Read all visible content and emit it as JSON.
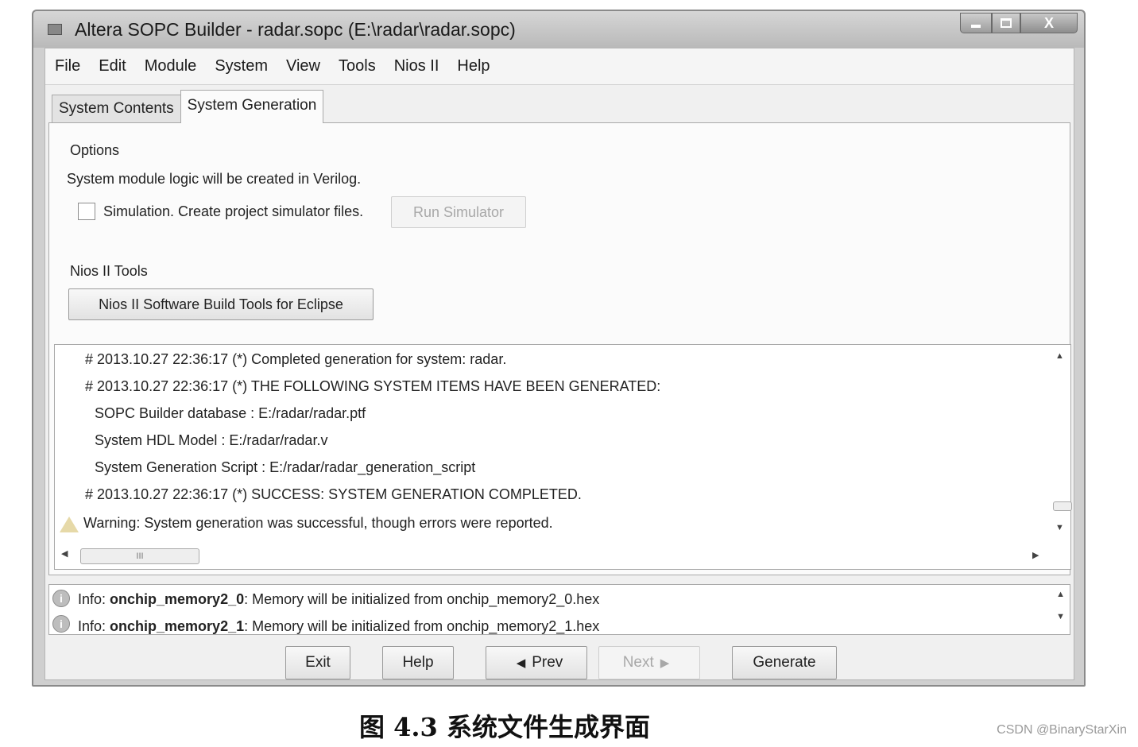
{
  "window": {
    "title": "Altera SOPC Builder - radar.sopc (E:\\radar\\radar.sopc)"
  },
  "menu": [
    "File",
    "Edit",
    "Module",
    "System",
    "View",
    "Tools",
    "Nios II",
    "Help"
  ],
  "tabs": [
    "System Contents",
    "System Generation"
  ],
  "active_tab": "System Generation",
  "options": {
    "label": "Options",
    "verilog_text": "System module logic will be created in Verilog.",
    "simulation_label": "Simulation. Create project simulator files.",
    "simulation_checked": false,
    "run_simulator": "Run Simulator"
  },
  "nios_tools": {
    "label": "Nios II Tools",
    "eclipse_button": "Nios II Software Build Tools for Eclipse"
  },
  "log": [
    "# 2013.10.27 22:36:17 (*) Completed generation for system: radar.",
    "# 2013.10.27 22:36:17 (*) THE FOLLOWING SYSTEM ITEMS HAVE BEEN GENERATED:",
    "SOPC Builder database : E:/radar/radar.ptf",
    "System HDL Model : E:/radar/radar.v",
    "System Generation Script : E:/radar/radar_generation_script",
    "# 2013.10.27 22:36:17 (*) SUCCESS: SYSTEM GENERATION COMPLETED.",
    "Warning: System generation was successful, though errors were reported."
  ],
  "info": [
    {
      "prefix": "Info: ",
      "name": "onchip_memory2_0",
      "text": ": Memory will be initialized from onchip_memory2_0.hex"
    },
    {
      "prefix": "Info: ",
      "name": "onchip_memory2_1",
      "text": ": Memory will be initialized from onchip_memory2_1.hex"
    }
  ],
  "buttons": {
    "exit": "Exit",
    "help": "Help",
    "prev": "Prev",
    "next": "Next",
    "generate": "Generate"
  },
  "icons": {
    "prev_arrow": "◀",
    "next_arrow": "▶",
    "close": "X",
    "scroll_h_thumb": "III"
  },
  "caption": "图 4.3  系统文件生成界面",
  "watermark": "CSDN @BinaryStarXin"
}
